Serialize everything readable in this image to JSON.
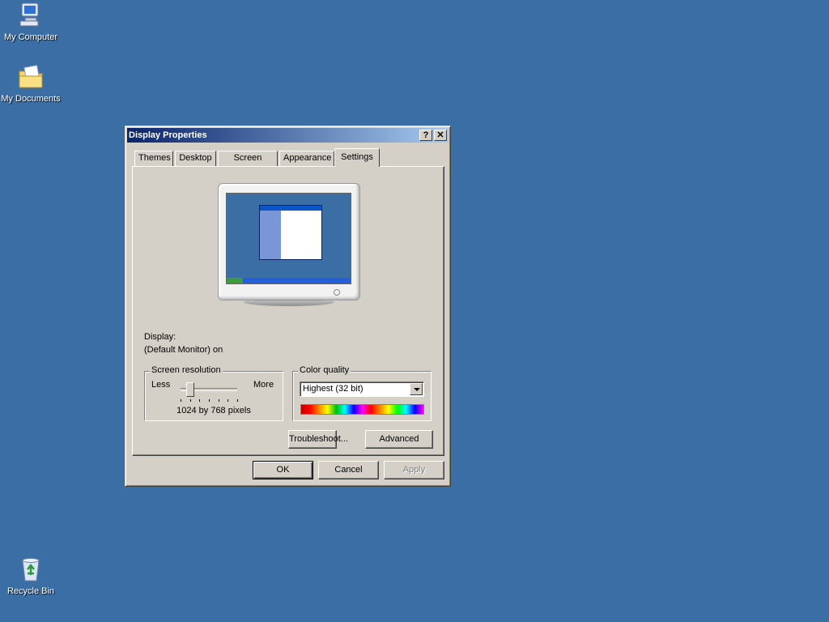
{
  "desktop": {
    "icons": [
      {
        "label": "My Computer",
        "icon": "my-computer-icon"
      },
      {
        "label": "My Documents",
        "icon": "my-documents-icon"
      },
      {
        "label": "Recycle Bin",
        "icon": "recycle-bin-icon"
      }
    ],
    "background_color": "#3a6ea5"
  },
  "window": {
    "title": "Display Properties",
    "help_glyph": "?",
    "close_glyph": "✕",
    "tabs": [
      {
        "label": "Themes",
        "active": false
      },
      {
        "label": "Desktop",
        "active": false
      },
      {
        "label": "Screen Saver",
        "active": false
      },
      {
        "label": "Appearance",
        "active": false
      },
      {
        "label": "Settings",
        "active": true
      }
    ],
    "display_label": "Display:",
    "display_value": "(Default Monitor) on",
    "screen_resolution": {
      "title": "Screen resolution",
      "less_label": "Less",
      "more_label": "More",
      "value_text": "1024 by 768 pixels",
      "slider_position": 1,
      "slider_steps": 7
    },
    "color_quality": {
      "title": "Color quality",
      "selected": "Highest (32 bit)"
    },
    "buttons": {
      "troubleshoot": "Troubleshoot...",
      "advanced": "Advanced",
      "ok": "OK",
      "cancel": "Cancel",
      "apply": "Apply"
    }
  }
}
